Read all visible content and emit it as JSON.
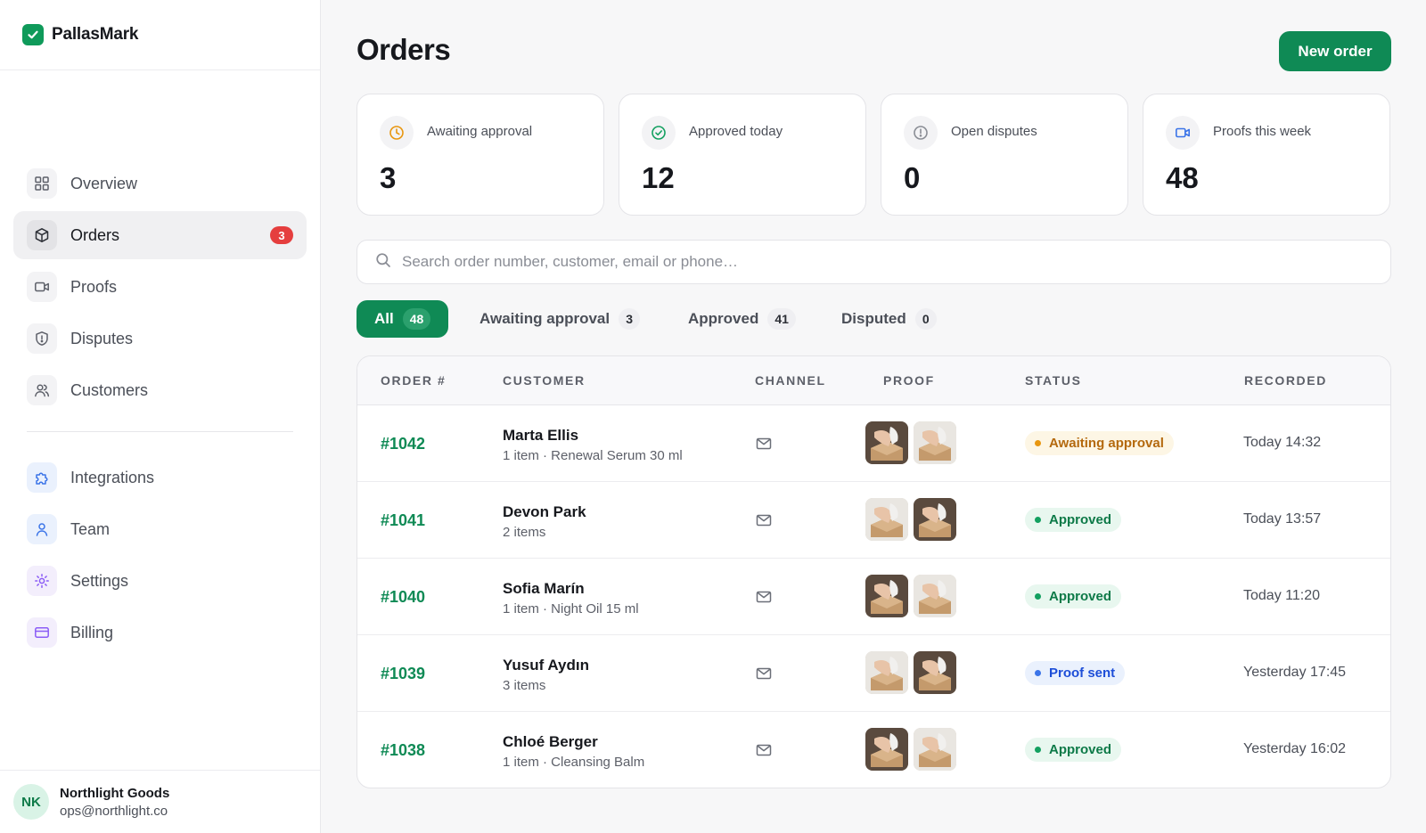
{
  "brand": {
    "name": "PallasMark"
  },
  "nav": {
    "items": [
      {
        "label": "Overview",
        "icon": "grid-icon"
      },
      {
        "label": "Orders",
        "icon": "box-icon",
        "badge": "3",
        "active": true
      },
      {
        "label": "Proofs",
        "icon": "video-icon"
      },
      {
        "label": "Disputes",
        "icon": "shield-icon"
      },
      {
        "label": "Customers",
        "icon": "users-icon"
      }
    ],
    "secondary": [
      {
        "label": "Integrations",
        "icon": "puzzle-icon"
      },
      {
        "label": "Team",
        "icon": "user-icon"
      },
      {
        "label": "Settings",
        "icon": "gear-icon"
      },
      {
        "label": "Billing",
        "icon": "credit-card-icon"
      }
    ]
  },
  "account": {
    "initials": "NK",
    "name": "Northlight Goods",
    "email": "ops@northlight.co"
  },
  "header": {
    "title": "Orders",
    "new_order_label": "New order"
  },
  "stats": [
    {
      "label": "Awaiting approval",
      "value": "3",
      "icon": "clock-icon",
      "color": "#e8960f"
    },
    {
      "label": "Approved today",
      "value": "12",
      "icon": "check-circle-icon",
      "color": "#13a060"
    },
    {
      "label": "Open disputes",
      "value": "0",
      "icon": "alert-circle-icon",
      "color": "#8a8d95"
    },
    {
      "label": "Proofs this week",
      "value": "48",
      "icon": "video-icon",
      "color": "#3b74e8"
    }
  ],
  "search": {
    "placeholder": "Search order number, customer, email or phone…",
    "value": ""
  },
  "tabs": [
    {
      "label": "All",
      "count": "48",
      "active": true
    },
    {
      "label": "Awaiting approval",
      "count": "3"
    },
    {
      "label": "Approved",
      "count": "41"
    },
    {
      "label": "Disputed",
      "count": "0"
    }
  ],
  "table": {
    "headers": [
      "ORDER #",
      "CUSTOMER",
      "CHANNEL",
      "PROOF",
      "STATUS",
      "RECORDED"
    ],
    "rows": [
      {
        "order": "#1042",
        "customer": "Marta Ellis",
        "detail": "1 item · Renewal Serum 30 ml",
        "channel": "mail-icon",
        "status": "Awaiting approval",
        "status_kind": "await",
        "recorded": "Today 14:32"
      },
      {
        "order": "#1041",
        "customer": "Devon Park",
        "detail": "2 items",
        "channel": "mail-icon",
        "status": "Approved",
        "status_kind": "ok",
        "recorded": "Today 13:57"
      },
      {
        "order": "#1040",
        "customer": "Sofia Marín",
        "detail": "1 item · Night Oil 15 ml",
        "channel": "mail-icon",
        "status": "Approved",
        "status_kind": "ok",
        "recorded": "Today 11:20"
      },
      {
        "order": "#1039",
        "customer": "Yusuf Aydın",
        "detail": "3 items",
        "channel": "mail-icon",
        "status": "Proof sent",
        "status_kind": "sent",
        "recorded": "Yesterday 17:45"
      },
      {
        "order": "#1038",
        "customer": "Chloé Berger",
        "detail": "1 item · Cleansing Balm",
        "channel": "mail-icon",
        "status": "Approved",
        "status_kind": "ok",
        "recorded": "Yesterday 16:02"
      }
    ]
  }
}
